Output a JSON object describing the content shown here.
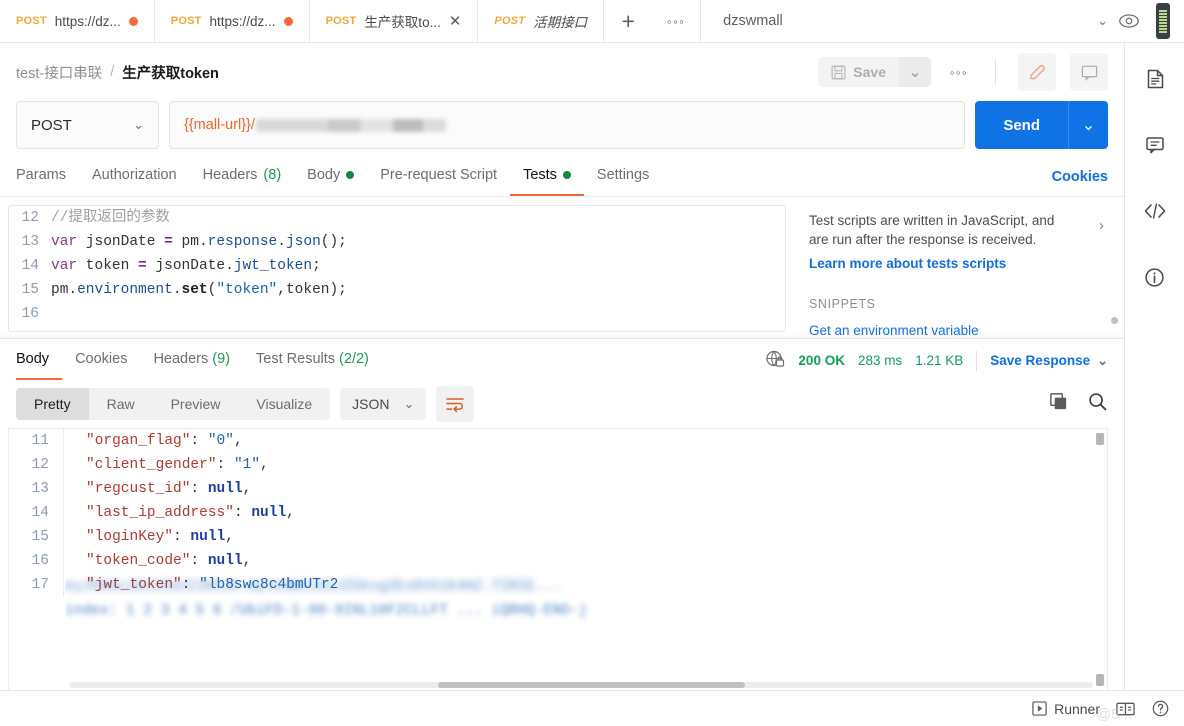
{
  "tabbar": {
    "tabs": [
      {
        "method": "POST",
        "name": "https://dz...",
        "unsaved": true,
        "active": false,
        "italic": false
      },
      {
        "method": "POST",
        "name": "https://dz...",
        "unsaved": true,
        "active": false,
        "italic": false
      },
      {
        "method": "POST",
        "name": "生产获取to...",
        "unsaved": false,
        "active": true,
        "italic": false,
        "close": "✕"
      },
      {
        "method": "POST",
        "name": "活期接口",
        "unsaved": false,
        "active": false,
        "italic": true
      }
    ],
    "new_tab_label": "+",
    "more_label": "◦◦◦",
    "environment": "dzswmall",
    "env_caret": "⌄"
  },
  "header": {
    "breadcrumb_parent": "test-接口串联",
    "breadcrumb_sep": "/",
    "breadcrumb_current": "生产获取token",
    "save_label": "Save",
    "save_caret": "⌄",
    "more_label": "◦◦◦"
  },
  "request": {
    "method": "POST",
    "method_caret": "⌄",
    "url_variable": "{{mall-url}}/",
    "send_label": "Send",
    "send_caret": "⌄",
    "tabs": [
      {
        "label": "Params",
        "count": "",
        "dot": false,
        "active": false
      },
      {
        "label": "Authorization",
        "count": "",
        "dot": false,
        "active": false
      },
      {
        "label": "Headers",
        "count": "(8)",
        "dot": false,
        "active": false
      },
      {
        "label": "Body",
        "count": "",
        "dot": true,
        "active": false
      },
      {
        "label": "Pre-request Script",
        "count": "",
        "dot": false,
        "active": false
      },
      {
        "label": "Tests",
        "count": "",
        "dot": true,
        "active": true
      },
      {
        "label": "Settings",
        "count": "",
        "dot": false,
        "active": false
      }
    ],
    "cookies_link": "Cookies"
  },
  "script_editor": {
    "lines": [
      {
        "no": "12",
        "tokens": [
          {
            "t": "//提取返回的参数",
            "c": "cm"
          }
        ]
      },
      {
        "no": "13",
        "tokens": [
          {
            "t": "var",
            "c": "kw"
          },
          {
            "t": " jsonDate ",
            "c": "id"
          },
          {
            "t": "=",
            "c": "op"
          },
          {
            "t": " pm",
            "c": "id"
          },
          {
            "t": ".",
            "c": "pn"
          },
          {
            "t": "response",
            "c": "fn"
          },
          {
            "t": ".",
            "c": "pn"
          },
          {
            "t": "json",
            "c": "fn"
          },
          {
            "t": "();",
            "c": "pn"
          }
        ]
      },
      {
        "no": "14",
        "tokens": [
          {
            "t": "var",
            "c": "kw"
          },
          {
            "t": " token ",
            "c": "id"
          },
          {
            "t": "=",
            "c": "op"
          },
          {
            "t": " jsonDate",
            "c": "id"
          },
          {
            "t": ".",
            "c": "pn"
          },
          {
            "t": "jwt_token",
            "c": "fn"
          },
          {
            "t": ";",
            "c": "pn"
          }
        ]
      },
      {
        "no": "15",
        "tokens": [
          {
            "t": "pm",
            "c": "id"
          },
          {
            "t": ".",
            "c": "pn"
          },
          {
            "t": "environment",
            "c": "fn"
          },
          {
            "t": ".",
            "c": "pn"
          },
          {
            "t": "set",
            "c": "bld"
          },
          {
            "t": "(",
            "c": "pn"
          },
          {
            "t": "\"token\"",
            "c": "str"
          },
          {
            "t": ",token);",
            "c": "pn"
          }
        ]
      },
      {
        "no": "16",
        "tokens": [
          {
            "t": "",
            "c": "pn"
          }
        ]
      }
    ]
  },
  "snippets": {
    "description": "Test scripts are written in JavaScript, and are run after the response is received.",
    "learn_more": "Learn more about tests scripts",
    "heading": "SNIPPETS",
    "first_item": "Get an environment variable",
    "chevron": "›"
  },
  "response": {
    "tabs": [
      {
        "label": "Body",
        "count": "",
        "active": true
      },
      {
        "label": "Cookies",
        "count": "",
        "active": false
      },
      {
        "label": "Headers",
        "count": "(9)",
        "active": false
      },
      {
        "label": "Test Results",
        "count": "(2/2)",
        "active": false
      }
    ],
    "status": "200 OK",
    "time": "283 ms",
    "size": "1.21 KB",
    "save_response": "Save Response",
    "save_response_caret": "⌄",
    "view_modes": [
      {
        "label": "Pretty",
        "active": true
      },
      {
        "label": "Raw",
        "active": false
      },
      {
        "label": "Preview",
        "active": false
      },
      {
        "label": "Visualize",
        "active": false
      }
    ],
    "format": "JSON",
    "format_caret": "⌄",
    "lines": [
      {
        "no": "11",
        "tokens": [
          {
            "t": "\"organ_flag\"",
            "c": "jkey"
          },
          {
            "t": ": ",
            "c": "jpun"
          },
          {
            "t": "\"0\"",
            "c": "jstr"
          },
          {
            "t": ",",
            "c": "jpun"
          }
        ]
      },
      {
        "no": "12",
        "tokens": [
          {
            "t": "\"client_gender\"",
            "c": "jkey"
          },
          {
            "t": ": ",
            "c": "jpun"
          },
          {
            "t": "\"1\"",
            "c": "jstr"
          },
          {
            "t": ",",
            "c": "jpun"
          }
        ]
      },
      {
        "no": "13",
        "tokens": [
          {
            "t": "\"regcust_id\"",
            "c": "jkey"
          },
          {
            "t": ": ",
            "c": "jpun"
          },
          {
            "t": "null",
            "c": "jnull"
          },
          {
            "t": ",",
            "c": "jpun"
          }
        ]
      },
      {
        "no": "14",
        "tokens": [
          {
            "t": "\"last_ip_address\"",
            "c": "jkey"
          },
          {
            "t": ": ",
            "c": "jpun"
          },
          {
            "t": "null",
            "c": "jnull"
          },
          {
            "t": ",",
            "c": "jpun"
          }
        ]
      },
      {
        "no": "15",
        "tokens": [
          {
            "t": "\"loginKey\"",
            "c": "jkey"
          },
          {
            "t": ": ",
            "c": "jpun"
          },
          {
            "t": "null",
            "c": "jnull"
          },
          {
            "t": ",",
            "c": "jpun"
          }
        ]
      },
      {
        "no": "16",
        "tokens": [
          {
            "t": "\"token_code\"",
            "c": "jkey"
          },
          {
            "t": ": ",
            "c": "jpun"
          },
          {
            "t": "null",
            "c": "jnull"
          },
          {
            "t": ",",
            "c": "jpun"
          }
        ]
      },
      {
        "no": "17",
        "tokens": [
          {
            "t": "\"jwt_token\"",
            "c": "jkey"
          },
          {
            "t": ": ",
            "c": "jpun"
          },
          {
            "t": "\"lb8swc8c4bmUTr2",
            "c": "jstr"
          }
        ]
      }
    ],
    "redacted_line_1": "eyJhbGciOiJIUzI1NiJ9.eyJzdWIiOiJZ5kvg2Ex0VX1K4HZ.TIRIE...",
    "redacted_line_2": "index: 1  2  3  4  5  6 /UbiFD-1-00-9INL10F2CLLFT ... iQRHQ-END-j"
  },
  "bottom": {
    "runner": "Runner",
    "watermark": "@5...",
    "help": "?"
  }
}
